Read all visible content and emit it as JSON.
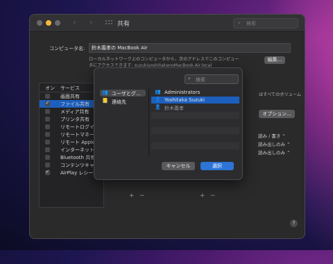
{
  "window": {
    "title": "共有",
    "search_placeholder": "検索"
  },
  "computer_name": {
    "label": "コンピュータ名:",
    "value": "鈴木義孝の MacBook Air",
    "description": "ローカルネットワーク上のコンピュータから、次のアドレスでこのコンピュータにアクセスできます: suzukiyoshitakanoMacBook-Air.local",
    "edit_label": "編集..."
  },
  "services": {
    "col_on": "オン",
    "col_service": "サービス",
    "items": [
      {
        "label": "画面共有",
        "on": false,
        "selected": false
      },
      {
        "label": "ファイル共有",
        "on": true,
        "selected": true
      },
      {
        "label": "メディア共有",
        "on": false,
        "selected": false
      },
      {
        "label": "プリンタ共有",
        "on": false,
        "selected": false
      },
      {
        "label": "リモートログイン",
        "on": false,
        "selected": false
      },
      {
        "label": "リモートマネージ",
        "on": false,
        "selected": false
      },
      {
        "label": "リモート Apple E",
        "on": false,
        "selected": false
      },
      {
        "label": "インターネット共",
        "on": false,
        "selected": false
      },
      {
        "label": "Bluetooth 共有",
        "on": false,
        "selected": false
      },
      {
        "label": "コンテンツキャッ",
        "on": false,
        "selected": false
      },
      {
        "label": "AirPlay レシーバー",
        "on": true,
        "selected": false
      }
    ]
  },
  "right_panel": {
    "volume_text": "はすべてのボリューム",
    "options_label": "オプション...",
    "permissions": [
      "読み / 書き ⌃",
      "読み出しのみ ⌃",
      "読み出しのみ ⌃"
    ]
  },
  "dialog": {
    "search_placeholder": "検索",
    "sources": [
      {
        "label": "ユーザとグ…",
        "icon": "users-group-icon",
        "highlighted": true
      },
      {
        "label": "連絡先",
        "icon": "contacts-icon",
        "highlighted": false
      }
    ],
    "users": [
      {
        "label": "Administrators",
        "icon": "group-icon",
        "selected": false
      },
      {
        "label": "Yoshitaka Suzuki",
        "icon": "user-icon",
        "selected": true
      },
      {
        "label": "鈴木義孝",
        "icon": "user-icon",
        "selected": false,
        "sub": true
      }
    ],
    "cancel_label": "キャンセル",
    "select_label": "選択"
  },
  "colors": {
    "accent": "#2c74d6",
    "selection": "#1d5fbd",
    "window_bg": "#2a2a2b"
  }
}
